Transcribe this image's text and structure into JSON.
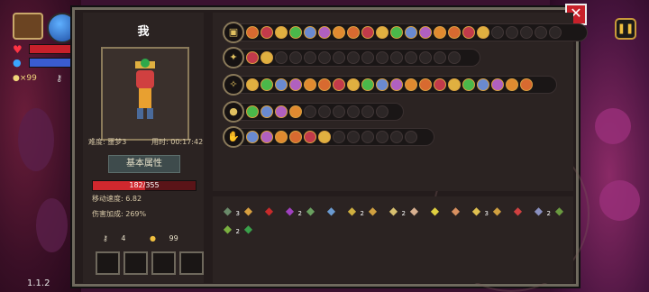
{
  "hud": {
    "coins": "99",
    "version": "1.1.2"
  },
  "character": {
    "name": "我",
    "difficulty": "难度: 噩梦3",
    "time": "用时: 00:17:42",
    "attr_tab": "基本属性",
    "hp_text": "182/355",
    "hp_fraction": 0.513,
    "move_speed": "移动速度: 6.82",
    "damage": "伤害加成: 269%",
    "keys": "4",
    "gold": "99"
  },
  "rows": [
    {
      "icon": "chest-icon",
      "filled": 17,
      "total": 22
    },
    {
      "icon": "staff-icon",
      "filled": 2,
      "total": 15
    },
    {
      "icon": "wand-icon",
      "filled": 20,
      "total": 20
    },
    {
      "icon": "gold-orb-icon",
      "filled": 4,
      "total": 10
    },
    {
      "icon": "claw-icon",
      "filled": 6,
      "total": 12
    }
  ],
  "inventory": [
    {
      "icon": "helmet-icon",
      "count": "3"
    },
    {
      "icon": "rope-icon",
      "count": ""
    },
    {
      "icon": "red-gem-icon",
      "count": ""
    },
    {
      "icon": "boot-icon",
      "count": "2"
    },
    {
      "icon": "green-book-icon",
      "count": ""
    },
    {
      "icon": "wings-icon",
      "count": ""
    },
    {
      "icon": "snake-icon",
      "count": "2"
    },
    {
      "icon": "amulet-icon",
      "count": ""
    },
    {
      "icon": "magnifier-icon",
      "count": "2"
    },
    {
      "icon": "roast-icon",
      "count": ""
    },
    {
      "icon": "horn-icon",
      "count": ""
    },
    {
      "icon": "egg-icon",
      "count": ""
    },
    {
      "icon": "ring-icon",
      "count": "3"
    },
    {
      "icon": "pickaxe-icon",
      "count": ""
    },
    {
      "icon": "bull-icon",
      "count": ""
    },
    {
      "icon": "feather-icon",
      "count": "2"
    },
    {
      "icon": "sock-icon",
      "count": ""
    },
    {
      "icon": "leaf-icon",
      "count": "2"
    },
    {
      "icon": "clover-icon",
      "count": ""
    }
  ]
}
